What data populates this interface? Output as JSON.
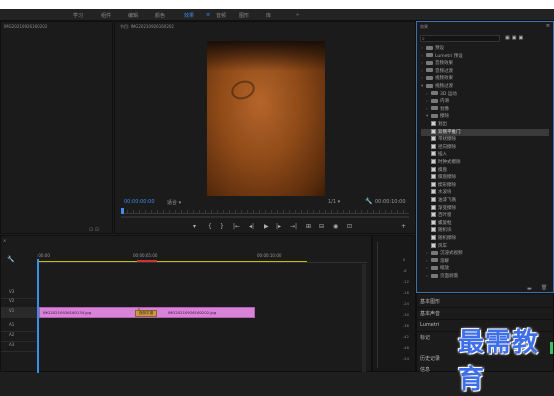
{
  "workspace_tabs": [
    "学习",
    "组件",
    "编辑",
    "颜色",
    "效果",
    "音频",
    "图形",
    "库"
  ],
  "workspace_more": "»",
  "source_panel": {
    "title": "IMG20210926160202"
  },
  "program_panel": {
    "title": "节目: IMG20210926160202",
    "current_tc": "00:00:00:00",
    "fit_label": "适合",
    "ratio_label": "1/1",
    "duration_tc": "00:00:10:00"
  },
  "transport": [
    "▾",
    "{",
    "}",
    "|←",
    "◂|",
    "▶",
    "|▸",
    "→|",
    "⊞",
    "⊟",
    "◉",
    "⊡",
    "+"
  ],
  "effects_panel": {
    "title": "效果",
    "tree": [
      {
        "label": "预设",
        "level": 0,
        "type": "folder"
      },
      {
        "label": "Lumetri 预设",
        "level": 0,
        "type": "folder"
      },
      {
        "label": "音频效果",
        "level": 0,
        "type": "folder"
      },
      {
        "label": "音频过渡",
        "level": 0,
        "type": "folder"
      },
      {
        "label": "视频效果",
        "level": 0,
        "type": "folder"
      },
      {
        "label": "视频过渡",
        "level": 0,
        "type": "folder",
        "open": true
      },
      {
        "label": "3D 运动",
        "level": 1,
        "type": "folder"
      },
      {
        "label": "内滑",
        "level": 1,
        "type": "folder"
      },
      {
        "label": "划像",
        "level": 1,
        "type": "folder"
      },
      {
        "label": "擦除",
        "level": 1,
        "type": "folder",
        "open": true
      },
      {
        "label": "划出",
        "level": 2,
        "type": "fx"
      },
      {
        "label": "双侧平推门",
        "level": 2,
        "type": "fx",
        "selected": true
      },
      {
        "label": "带状擦除",
        "level": 2,
        "type": "fx"
      },
      {
        "label": "径向擦除",
        "level": 2,
        "type": "fx"
      },
      {
        "label": "插入",
        "level": 2,
        "type": "fx"
      },
      {
        "label": "时钟式擦除",
        "level": 2,
        "type": "fx"
      },
      {
        "label": "棋盘",
        "level": 2,
        "type": "fx"
      },
      {
        "label": "棋盘擦除",
        "level": 2,
        "type": "fx"
      },
      {
        "label": "楔形擦除",
        "level": 2,
        "type": "fx"
      },
      {
        "label": "水波块",
        "level": 2,
        "type": "fx"
      },
      {
        "label": "油漆飞溅",
        "level": 2,
        "type": "fx"
      },
      {
        "label": "渐变擦除",
        "level": 2,
        "type": "fx"
      },
      {
        "label": "百叶窗",
        "level": 2,
        "type": "fx"
      },
      {
        "label": "螺旋框",
        "level": 2,
        "type": "fx"
      },
      {
        "label": "随机块",
        "level": 2,
        "type": "fx"
      },
      {
        "label": "随机擦除",
        "level": 2,
        "type": "fx"
      },
      {
        "label": "风车",
        "level": 2,
        "type": "fx"
      },
      {
        "label": "沉浸式视频",
        "level": 1,
        "type": "folder"
      },
      {
        "label": "溶解",
        "level": 1,
        "type": "folder"
      },
      {
        "label": "缩放",
        "level": 1,
        "type": "folder"
      },
      {
        "label": "页面剥落",
        "level": 1,
        "type": "folder"
      }
    ]
  },
  "lower_right": {
    "items": [
      "基本图形",
      "基本声音",
      "Lumetri",
      "标记",
      "历史记录",
      "信息"
    ]
  },
  "timeline": {
    "ruler_start": ":00:00",
    "ruler_mid": "00:00:05:00",
    "ruler_end": "00:00:10:00",
    "clip_a": "IMG20210926160134.jpg",
    "clip_b": "IMG20210926160202.jpg",
    "transition_label": "双侧平推",
    "track_labels": [
      "V3",
      "V2",
      "V1",
      "A1",
      "A2",
      "A3"
    ]
  },
  "meters": {
    "scale": [
      "0",
      "-6",
      "-12",
      "-18",
      "-24",
      "-30",
      "-36",
      "-42",
      "-48",
      "-54"
    ]
  },
  "watermark": "最需教育"
}
